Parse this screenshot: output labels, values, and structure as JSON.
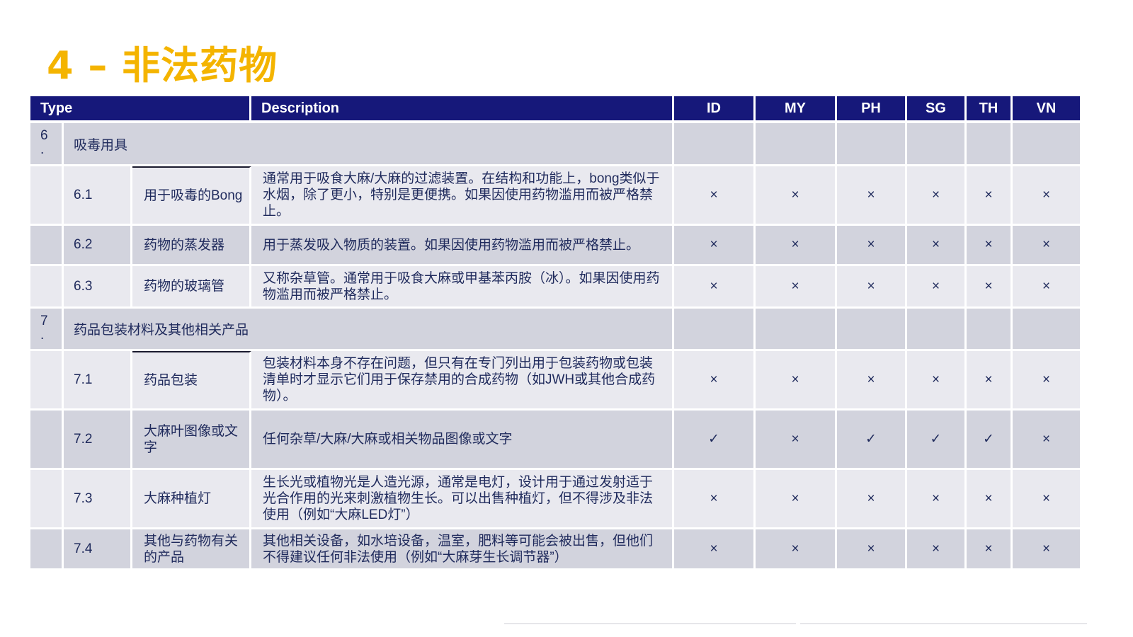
{
  "title": "4 – 非法药物",
  "headers": {
    "type": "Type",
    "description": "Description",
    "countries": [
      "ID",
      "MY",
      "PH",
      "SG",
      "TH",
      "VN"
    ]
  },
  "sections": [
    {
      "number": "6",
      "dot": ".",
      "label": "吸毒用具",
      "items": [
        {
          "num": "6.1",
          "name": "用于吸毒的Bong",
          "desc": "通常用于吸食大麻/大麻的过滤装置。在结构和功能上，bong类似于水烟，除了更小，特别是更便携。如果因使用药物滥用而被严格禁止。",
          "marks": [
            "×",
            "×",
            "×",
            "×",
            "×",
            "×"
          ]
        },
        {
          "num": "6.2",
          "name": "药物的蒸发器",
          "desc": "用于蒸发吸入物质的装置。如果因使用药物滥用而被严格禁止。",
          "marks": [
            "×",
            "×",
            "×",
            "×",
            "×",
            "×"
          ]
        },
        {
          "num": "6.3",
          "name": "药物的玻璃管",
          "desc": "又称杂草管。通常用于吸食大麻或甲基苯丙胺（冰）。如果因使用药物滥用而被严格禁止。",
          "marks": [
            "×",
            "×",
            "×",
            "×",
            "×",
            "×"
          ]
        }
      ]
    },
    {
      "number": "7",
      "dot": ".",
      "label": "药品包装材料及其他相关产品",
      "items": [
        {
          "num": "7.1",
          "name": "药品包装",
          "desc": "包装材料本身不存在问题，但只有在专门列出用于包装药物或包装清单时才显示它们用于保存禁用的合成药物（如JWH或其他合成药物）。",
          "marks": [
            "×",
            "×",
            "×",
            "×",
            "×",
            "×"
          ]
        },
        {
          "num": "7.2",
          "name": "大麻叶图像或文字",
          "desc": "任何杂草/大麻/大麻或相关物品图像或文字",
          "marks": [
            "✓",
            "×",
            "✓",
            "✓",
            "✓",
            "×"
          ]
        },
        {
          "num": "7.3",
          "name": "大麻种植灯",
          "desc": "生长光或植物光是人造光源，通常是电灯，设计用于通过发射适于光合作用的光来刺激植物生长。可以出售种植灯，但不得涉及非法使用（例如“大麻LED灯”）",
          "marks": [
            "×",
            "×",
            "×",
            "×",
            "×",
            "×"
          ]
        },
        {
          "num": "7.4",
          "name": "其他与药物有关的产品",
          "desc": "其他相关设备，如水培设备，温室，肥料等可能会被出售，但他们不得建议任何非法使用（例如“大麻芽生长调节器”）",
          "marks": [
            "×",
            "×",
            "×",
            "×",
            "×",
            "×"
          ]
        }
      ]
    }
  ]
}
